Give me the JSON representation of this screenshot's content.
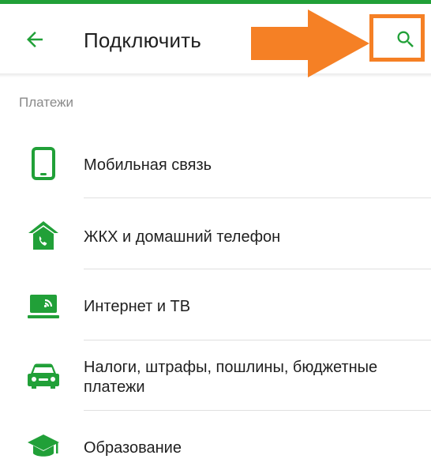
{
  "header": {
    "title": "Подключить",
    "back_icon": "arrow-left-icon",
    "search_icon": "search-icon"
  },
  "colors": {
    "accent": "#21a038",
    "annotation": "#f58025"
  },
  "section": {
    "title": "Платежи"
  },
  "items": [
    {
      "label": "Мобильная связь",
      "icon": "mobile-phone-icon"
    },
    {
      "label": "ЖКХ и домашний телефон",
      "icon": "house-phone-icon"
    },
    {
      "label": "Интернет и ТВ",
      "icon": "internet-tv-icon"
    },
    {
      "label": "Налоги, штрафы, пошлины, бюджетные платежи",
      "icon": "car-icon"
    },
    {
      "label": "Образование",
      "icon": "graduation-cap-icon"
    }
  ]
}
